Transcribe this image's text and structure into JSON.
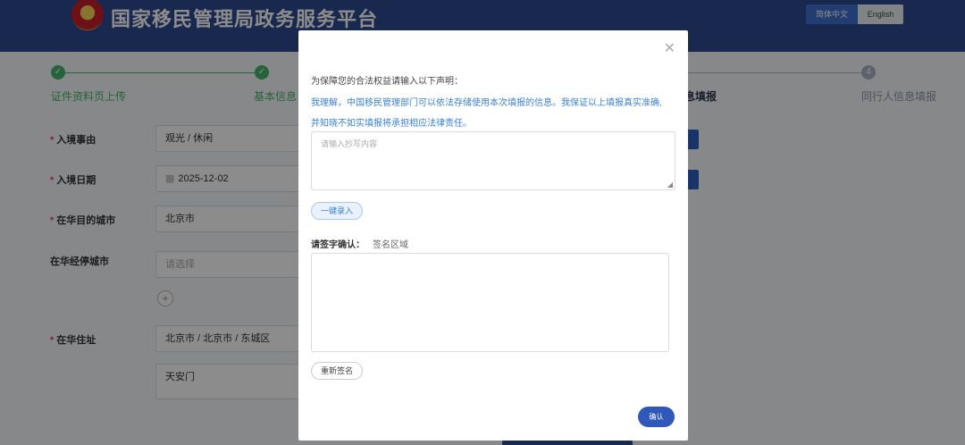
{
  "header": {
    "title": "国家移民管理局政务服务平台",
    "lang_cn": "简体中文",
    "lang_en": "English"
  },
  "steps": [
    {
      "label": "证件资料页上传",
      "status": "done"
    },
    {
      "label": "基本信息",
      "status": "done"
    },
    {
      "label": "息填报",
      "status": "current"
    },
    {
      "label": "同行人信息填报",
      "status": "pending",
      "number": "4"
    }
  ],
  "form": {
    "reason_label": "入境事由",
    "reason_value": "观光 / 休闲",
    "date_label": "入境日期",
    "date_value": "2025-12-02",
    "city_label": "在华目的城市",
    "city_value": "北京市",
    "transit_label": "在华经停城市",
    "transit_placeholder": "请选择",
    "address_label": "在华住址",
    "address_region": "北京市 / 北京市 / 东城区",
    "address_detail": "天安门"
  },
  "modal": {
    "intro": "为保障您的合法权益请输入以下声明：",
    "statement_line1": "我理解，中国移民管理部门可以依法存储使用本次填报的信息。我保证以上填报真实准确,",
    "statement_line2": "并知晓不如实填报将承担相应法律责任。",
    "textarea_placeholder": "请输入抄写内容",
    "fill_button": "一键录入",
    "sign_label": "请签字确认：",
    "sign_hint": "签名区域",
    "resign_button": "重新签名",
    "confirm_button": "确认"
  },
  "colors": {
    "header_bg": "#2c4a8f",
    "step_done": "#47b46a",
    "link_blue": "#3b82d6",
    "primary": "#2f58b8"
  }
}
